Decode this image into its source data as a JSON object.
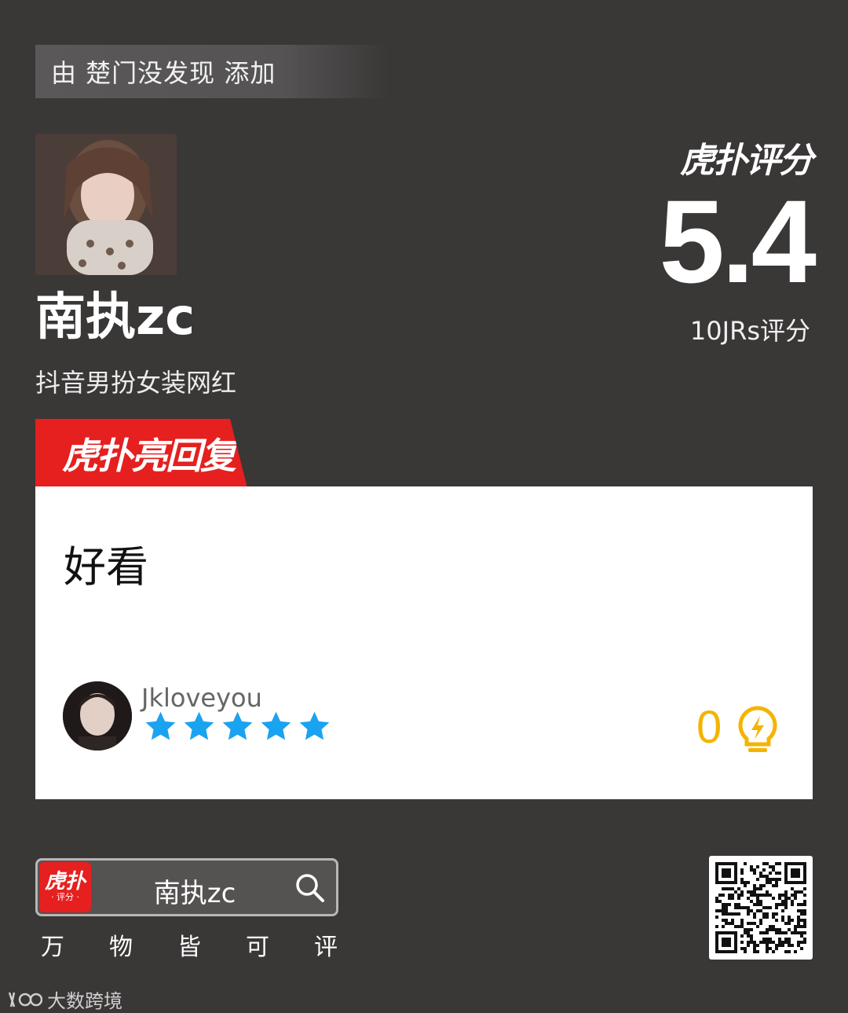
{
  "header": {
    "added_by": "由 楚门没发现 添加"
  },
  "subject": {
    "name": "南执zc",
    "description": "抖音男扮女装网红"
  },
  "score": {
    "brand": "虎扑评分",
    "value": "5.4",
    "count_text": "10JRs评分"
  },
  "hot_reply": {
    "tab_label": "虎扑亮回复",
    "text": "好看",
    "username": "Jkloveyou",
    "stars": 5,
    "likes": "0"
  },
  "footer": {
    "app_icon_big": "虎扑",
    "app_icon_small": "· 评分 ·",
    "search_text": "南执zc",
    "slogan": [
      "万",
      "物",
      "皆",
      "可",
      "评"
    ],
    "watermark": "大数跨境"
  },
  "colors": {
    "background": "#3a3737",
    "accent_red": "#e5201f",
    "star_blue": "#1aa3f0",
    "like_yellow": "#f4b400"
  },
  "icons": [
    "search-icon",
    "lightbulb-icon",
    "star-icon",
    "qr-code"
  ]
}
